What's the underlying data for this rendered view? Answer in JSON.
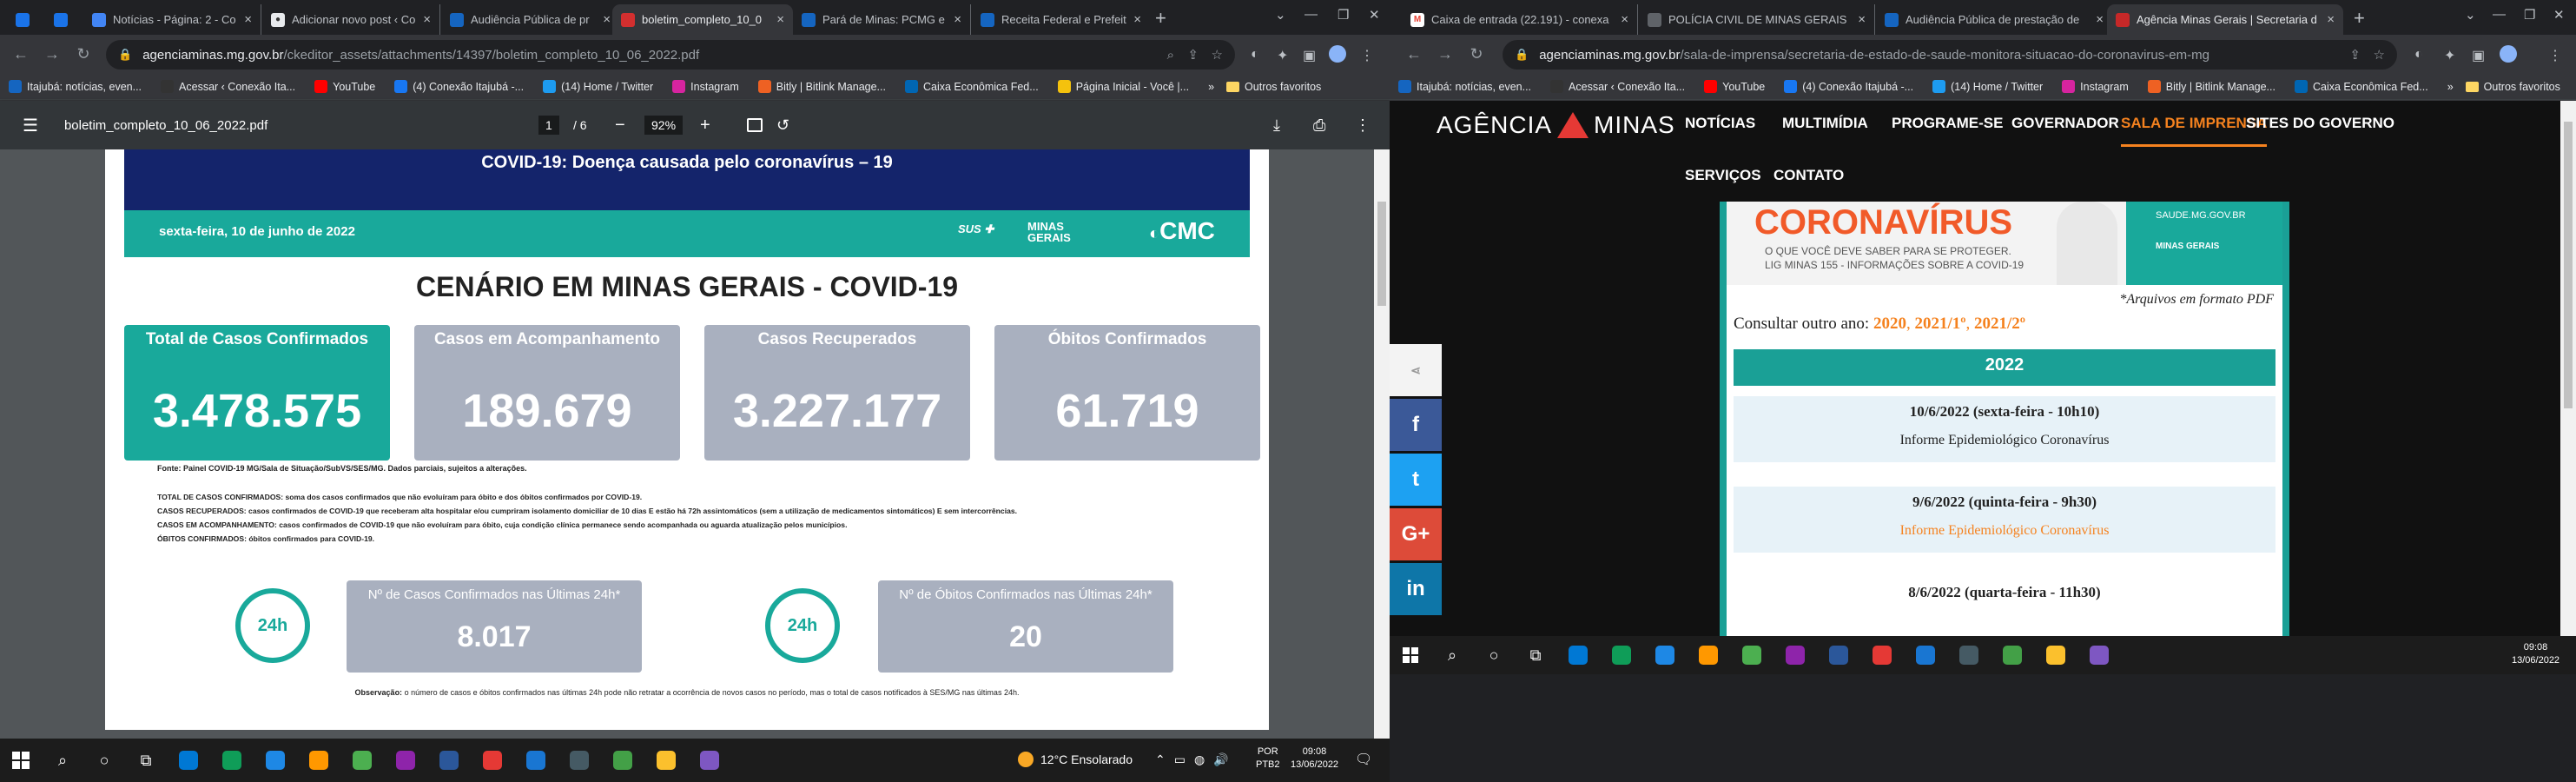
{
  "left_window": {
    "tabs": [
      {
        "title": "",
        "favicon": "#1a73e8"
      },
      {
        "title": "",
        "favicon": "#1a73e8"
      },
      {
        "title": "Notícias - Página: 2 - Co",
        "favicon": "#4285f4"
      },
      {
        "title": "Adicionar novo post ‹ Co",
        "favicon": "#e8eaed"
      },
      {
        "title": "Audiência Pública de pr",
        "favicon": "#1565c0"
      },
      {
        "title": "boletim_completo_10_0",
        "favicon": "#d32f2f"
      },
      {
        "title": "Pará de Minas: PCMG e",
        "favicon": "#1565c0"
      },
      {
        "title": "Receita Federal e Prefeit",
        "favicon": "#1565c0"
      }
    ],
    "url_host": "agenciaminas.mg.gov.br",
    "url_path": "/ckeditor_assets/attachments/14397/boletim_completo_10_06_2022.pdf",
    "bookmarks": [
      {
        "label": "Itajubá: notícias, even...",
        "color": "#1565c0"
      },
      {
        "label": "Acessar ‹ Conexão Ita...",
        "color": "#333"
      },
      {
        "label": "YouTube",
        "color": "#ff0000"
      },
      {
        "label": "(4) Conexão Itajubá -...",
        "color": "#1877f2"
      },
      {
        "label": "(14) Home / Twitter",
        "color": "#1d9bf0"
      },
      {
        "label": "Instagram",
        "color": "#d6249f"
      },
      {
        "label": "Bitly | Bitlink Manage...",
        "color": "#ee6123"
      },
      {
        "label": "Caixa Econômica Fed...",
        "color": "#0066b3"
      },
      {
        "label": "Página Inicial - Você |...",
        "color": "#f4c20d"
      }
    ],
    "bookmarks_more": "»",
    "other_favorites": "Outros favoritos",
    "pdf": {
      "filename": "boletim_completo_10_06_2022.pdf",
      "page_current": "1",
      "page_total": "/  6",
      "zoom": "92%",
      "banner_title": "COVID-19: Doença causada pelo coronavírus – 19",
      "date": "sexta-feira, 10 de junho de 2022",
      "logos": {
        "sus": "SUS",
        "minas": "MINAS GERAIS",
        "cmc": "CMC"
      },
      "heading": "CENÁRIO EM MINAS GERAIS - COVID-19",
      "cards": [
        {
          "label": "Total de Casos Confirmados",
          "value": "3.478.575"
        },
        {
          "label": "Casos em Acompanhamento",
          "value": "189.679"
        },
        {
          "label": "Casos Recuperados",
          "value": "3.227.177"
        },
        {
          "label": "Óbitos Confirmados",
          "value": "61.719"
        }
      ],
      "source": "Fonte: Painel COVID-19 MG/Sala de Situação/SubVS/SES/MG. Dados parciais, sujeitos a alterações.",
      "notes": [
        "TOTAL DE  CASOS CONFIRMADOS: soma dos casos confirmados que não evoluíram para óbito e dos óbitos confirmados por COVID-19.",
        "CASOS RECUPERADOS: casos confirmados de COVID-19 que receberam alta hospitalar e/ou cumpriram isolamento domiciliar de 10 dias E estão há 72h assintomáticos (sem a utilização de medicamentos sintomáticos) E sem intercorrências.",
        "CASOS EM ACOMPANHAMENTO: casos confirmados de COVID-19 que não evoluíram para óbito, cuja condição clínica permanece sendo acompanhada ou aguarda atualização pelos municípios.",
        "ÓBITOS CONFIRMADOS: óbitos confirmados para COVID-19."
      ],
      "last24": [
        {
          "label": "Nº de Casos Confirmados nas Últimas 24h*",
          "value": "8.017"
        },
        {
          "label": "Nº de Óbitos Confirmados nas Últimas 24h*",
          "value": "20"
        }
      ],
      "icon_24h": "24h",
      "observation_label": "Observação:",
      "observation_text": " o número de casos e óbitos confirmados nas últimas 24h pode não retratar a ocorrência de novos casos no período, mas o total de casos notificados à SES/MG nas últimas 24h."
    },
    "taskbar": {
      "weather": "12°C  Ensolarado",
      "lang": "POR",
      "layout": "PTB2",
      "time": "09:08",
      "date": "13/06/2022",
      "apps": [
        "#0078d4",
        "#0f9d58",
        "#1e88e5",
        "#ff9800",
        "#4caf50",
        "#8e24aa",
        "#2b579a",
        "#e53935",
        "#1976d2",
        "#455a64",
        "#43a047",
        "#fbc02d",
        "#7e57c2"
      ]
    }
  },
  "right_window": {
    "tabs": [
      {
        "title": "Caixa de entrada (22.191) - conexa",
        "favicon": "#ea4335"
      },
      {
        "title": "POLÍCIA CIVIL DE MINAS GERAIS",
        "favicon": "#5f6368"
      },
      {
        "title": "Audiência Pública de prestação de",
        "favicon": "#1565c0"
      },
      {
        "title": "Agência Minas Gerais | Secretaria d",
        "favicon": "#c62828"
      }
    ],
    "url_host": "agenciaminas.mg.gov.br",
    "url_path": "/sala-de-imprensa/secretaria-de-estado-de-saude-monitora-situacao-do-coronavirus-em-mg",
    "bookmarks": [
      {
        "label": "Itajubá: notícias, even...",
        "color": "#1565c0"
      },
      {
        "label": "Acessar ‹ Conexão Ita...",
        "color": "#333"
      },
      {
        "label": "YouTube",
        "color": "#ff0000"
      },
      {
        "label": "(4) Conexão Itajubá -...",
        "color": "#1877f2"
      },
      {
        "label": "(14) Home / Twitter",
        "color": "#1d9bf0"
      },
      {
        "label": "Instagram",
        "color": "#d6249f"
      },
      {
        "label": "Bitly | Bitlink Manage...",
        "color": "#ee6123"
      },
      {
        "label": "Caixa Econômica Fed...",
        "color": "#0066b3"
      }
    ],
    "bookmarks_more": "»",
    "other_favorites": "Outros favoritos",
    "site": {
      "logo_left": "AGÊNCIA",
      "logo_right": "MINAS",
      "nav": [
        "NOTÍCIAS",
        "MULTIMÍDIA",
        "PROGRAME-SE",
        "GOVERNADOR",
        "SALA DE IMPRENSA",
        "SITES DO GOVERNO",
        "SERVIÇOS",
        "CONTATO"
      ],
      "active_nav": "SALA DE IMPRENSA",
      "banner_title": "CORONAVÍRUS",
      "banner_sub1": "O QUE VOCÊ DEVE SABER PARA SE PROTEGER.",
      "banner_sub2": "LIG MINAS 155 - INFORMAÇÕES SOBRE A COVID-19",
      "banner_url": "SAUDE.MG.GOV.BR",
      "banner_logo": "MINAS GERAIS",
      "pdf_note": "*Arquivos em formato PDF",
      "consult_prefix": "Consultar outro ano: ",
      "years": [
        "2020",
        "2021/1º",
        "2021/2º"
      ],
      "year_header": "2022",
      "entries": [
        {
          "date": "10/6/2022 (sexta-feira - 10h10)",
          "link": "Informe Epidemiológico Coronavírus"
        },
        {
          "date": "9/6/2022 (quinta-feira - 9h30)",
          "link": "Informe Epidemiológico Coronavírus"
        },
        {
          "date": "8/6/2022 (quarta-feira - 11h30)",
          "link": ""
        }
      ],
      "share": [
        "share",
        "f",
        "t",
        "G+",
        "in"
      ]
    },
    "taskbar": {
      "time": "09:08",
      "date": "13/06/2022"
    }
  },
  "colors": {
    "teal": "#19a99b",
    "navy": "#14246b",
    "card_gray": "#a9b0bf",
    "orange": "#f5821f",
    "coral": "#e65c4f",
    "facebook": "#3b5998",
    "twitter": "#1da1f2",
    "gplus": "#dd4b39",
    "linkedin": "#0e76a8"
  }
}
